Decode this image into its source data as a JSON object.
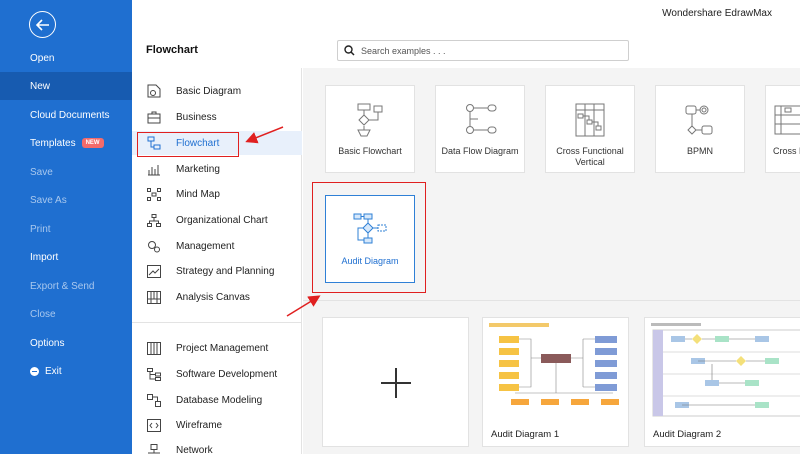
{
  "app": {
    "title": "Wondershare EdrawMax"
  },
  "nav": {
    "items": [
      {
        "label": "Open"
      },
      {
        "label": "New"
      },
      {
        "label": "Cloud Documents"
      },
      {
        "label": "Templates",
        "badge": "NEW"
      },
      {
        "label": "Save"
      },
      {
        "label": "Save As"
      },
      {
        "label": "Print"
      },
      {
        "label": "Import"
      },
      {
        "label": "Export & Send"
      },
      {
        "label": "Close"
      },
      {
        "label": "Options"
      },
      {
        "label": "Exit"
      }
    ]
  },
  "header": {
    "section_title": "Flowchart",
    "search_placeholder": "Search examples . . ."
  },
  "categories": [
    {
      "label": "Basic Diagram"
    },
    {
      "label": "Business"
    },
    {
      "label": "Flowchart"
    },
    {
      "label": "Marketing"
    },
    {
      "label": "Mind Map"
    },
    {
      "label": "Organizational Chart"
    },
    {
      "label": "Management"
    },
    {
      "label": "Strategy and Planning"
    },
    {
      "label": "Analysis Canvas"
    },
    {
      "label": "Project Management"
    },
    {
      "label": "Software Development"
    },
    {
      "label": "Database Modeling"
    },
    {
      "label": "Wireframe"
    },
    {
      "label": "Network"
    }
  ],
  "diagram_types": [
    {
      "label": "Basic Flowchart"
    },
    {
      "label": "Data Flow Diagram"
    },
    {
      "label": "Cross Functional Vertical"
    },
    {
      "label": "BPMN"
    },
    {
      "label": "Cross Functional Horizontal",
      "visible_label": "Cross F... Ho..."
    },
    {
      "label": "Audit Diagram"
    }
  ],
  "templates": [
    {
      "label": ""
    },
    {
      "label": "Audit Diagram 1"
    },
    {
      "label": "Audit Diagram 2"
    }
  ],
  "colors": {
    "nav_bg": "#1f6fd0",
    "accent": "#1f6fd0",
    "annotation_red": "#e02020",
    "badge": "#f36b6b"
  }
}
